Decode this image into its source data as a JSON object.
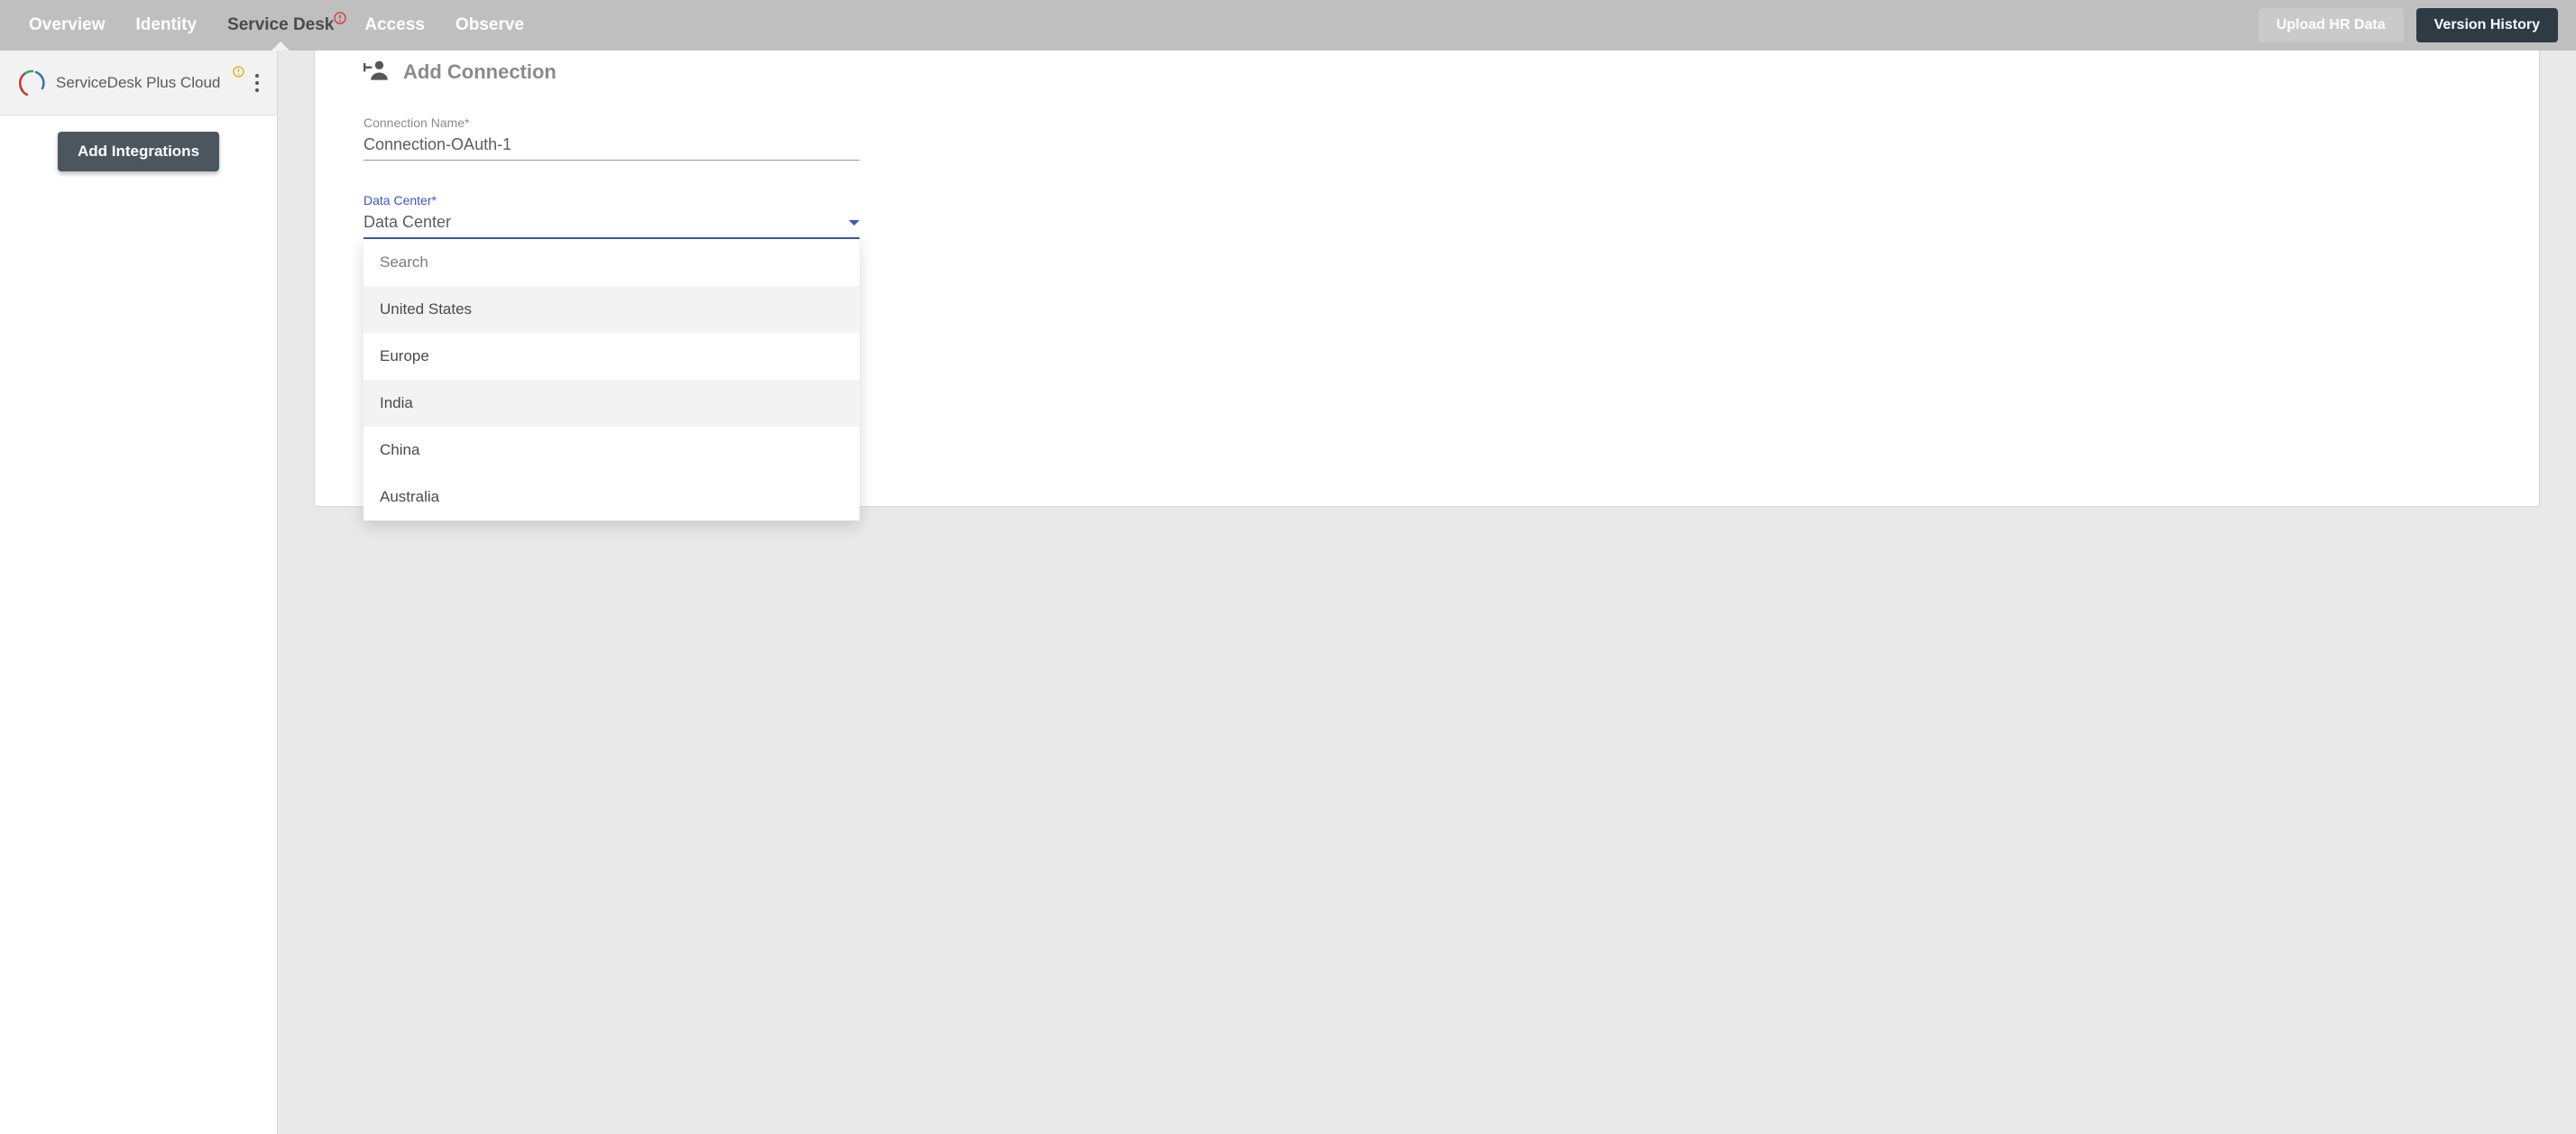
{
  "topbar": {
    "tabs": [
      {
        "label": "Overview"
      },
      {
        "label": "Identity"
      },
      {
        "label": "Service Desk",
        "active": true,
        "has_error_badge": true
      },
      {
        "label": "Access"
      },
      {
        "label": "Observe"
      }
    ],
    "upload_hr_label": "Upload HR Data",
    "version_history_label": "Version History"
  },
  "sidebar": {
    "integration_name": "ServiceDesk Plus Cloud",
    "has_warning_badge": true,
    "add_integrations_label": "Add Integrations"
  },
  "form": {
    "add_connection_title": "Add Connection",
    "connection_name": {
      "label": "Connection Name*",
      "value": "Connection-OAuth-1"
    },
    "data_center": {
      "label": "Data Center*",
      "placeholder": "Data Center",
      "search_placeholder": "Search",
      "options": [
        "United States",
        "Europe",
        "India",
        "China",
        "Australia"
      ]
    }
  }
}
